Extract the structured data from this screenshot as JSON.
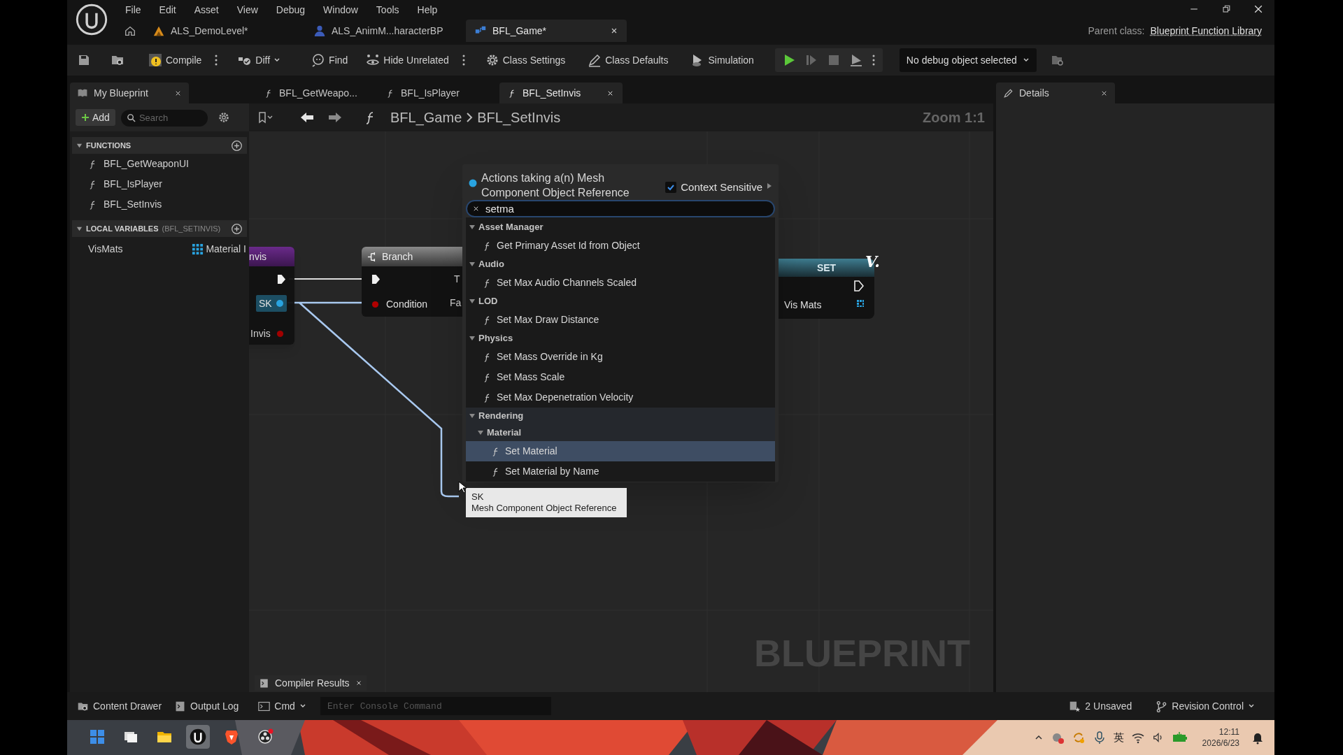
{
  "app_menu": [
    "File",
    "Edit",
    "Asset",
    "View",
    "Debug",
    "Window",
    "Tools",
    "Help"
  ],
  "document_tabs": [
    {
      "label": "ALS_DemoLevel*",
      "selected": false
    },
    {
      "label": "ALS_AnimM...haracterBP",
      "selected": false
    },
    {
      "label": "BFL_Game*",
      "selected": true
    }
  ],
  "parent_class": {
    "label": "Parent class:",
    "value": "Blueprint Function Library"
  },
  "toolbar": [
    {
      "label": "Compile"
    },
    {
      "label": "Diff"
    },
    {
      "label": "Find"
    },
    {
      "label": "Hide Unrelated"
    },
    {
      "label": "Class Settings"
    },
    {
      "label": "Class Defaults"
    },
    {
      "label": "Simulation"
    }
  ],
  "debug_filter": "No debug object selected",
  "my_blueprint": {
    "tab": "My Blueprint",
    "add": "Add",
    "search_placeholder": "Search",
    "functions": {
      "title": "FUNCTIONS",
      "expanded": true,
      "items": [
        "BFL_GetWeaponUI",
        "BFL_IsPlayer",
        "BFL_SetInvis"
      ]
    },
    "local_variables": {
      "title": "LOCAL VARIABLES",
      "scope": "(BFL_SETINVIS)",
      "expanded": true,
      "items": [
        {
          "name": "VisMats",
          "type": "Material I"
        }
      ]
    }
  },
  "graph_tabs": [
    {
      "label": "BFL_GetWeapo...",
      "selected": false
    },
    {
      "label": "BFL_IsPlayer",
      "selected": false
    },
    {
      "label": "BFL_SetInvis",
      "selected": true
    }
  ],
  "breadcrumb": [
    "BFL_Game",
    "BFL_SetInvis"
  ],
  "zoom": "Zoom 1:1",
  "graph_watermark": "BLUEPRINT",
  "nodes": [
    {
      "kind": "entry",
      "title": "nvis",
      "pins": [
        "SK",
        "Invis"
      ]
    },
    {
      "kind": "branch",
      "title": "Branch",
      "pins": [
        "Condition"
      ],
      "outputs": [
        "T",
        "Fa"
      ]
    },
    {
      "kind": "set",
      "title": "SET",
      "pins": [
        "Vis Mats"
      ]
    }
  ],
  "corner_mark": "V.",
  "action_menu": {
    "title": "Actions taking a(n) Mesh Component Object Reference",
    "context_sensitive": {
      "label": "Context Sensitive",
      "checked": true
    },
    "search": "setma",
    "tree": [
      {
        "kind": "category",
        "label": "Asset Manager",
        "expanded": true,
        "children": [
          {
            "kind": "function",
            "label": "Get Primary Asset Id from Object",
            "selected": false
          }
        ]
      },
      {
        "kind": "category",
        "label": "Audio",
        "expanded": true,
        "children": [
          {
            "kind": "function",
            "label": "Set Max Audio Channels Scaled",
            "selected": false
          }
        ]
      },
      {
        "kind": "category",
        "label": "LOD",
        "expanded": true,
        "children": [
          {
            "kind": "function",
            "label": "Set Max Draw Distance",
            "selected": false
          }
        ]
      },
      {
        "kind": "category",
        "label": "Physics",
        "expanded": true,
        "children": [
          {
            "kind": "function",
            "label": "Set Mass Override in Kg",
            "selected": false
          },
          {
            "kind": "function",
            "label": "Set Mass Scale",
            "selected": false
          },
          {
            "kind": "function",
            "label": "Set Max Depenetration Velocity",
            "selected": false
          }
        ]
      },
      {
        "kind": "category",
        "label": "Rendering",
        "expanded": true,
        "children": [
          {
            "kind": "category",
            "label": "Material",
            "expanded": true,
            "children": [
              {
                "kind": "function",
                "label": "Set Material",
                "selected": true
              },
              {
                "kind": "function",
                "label": "Set Material by Name",
                "selected": false
              }
            ]
          }
        ]
      }
    ]
  },
  "tooltip": {
    "name": "SK",
    "type": "Mesh Component Object Reference"
  },
  "details_tab": "Details",
  "bottom_bar": {
    "left": [
      "Content Drawer",
      "Output Log"
    ],
    "floating_tab": "Compiler Results",
    "cmd": "Cmd",
    "console_placeholder": "Enter Console Command",
    "right": [
      "2 Unsaved",
      "Revision Control"
    ]
  },
  "taskbar": {
    "input_method": "英",
    "time": "12:11",
    "date": "2026/6/23"
  }
}
